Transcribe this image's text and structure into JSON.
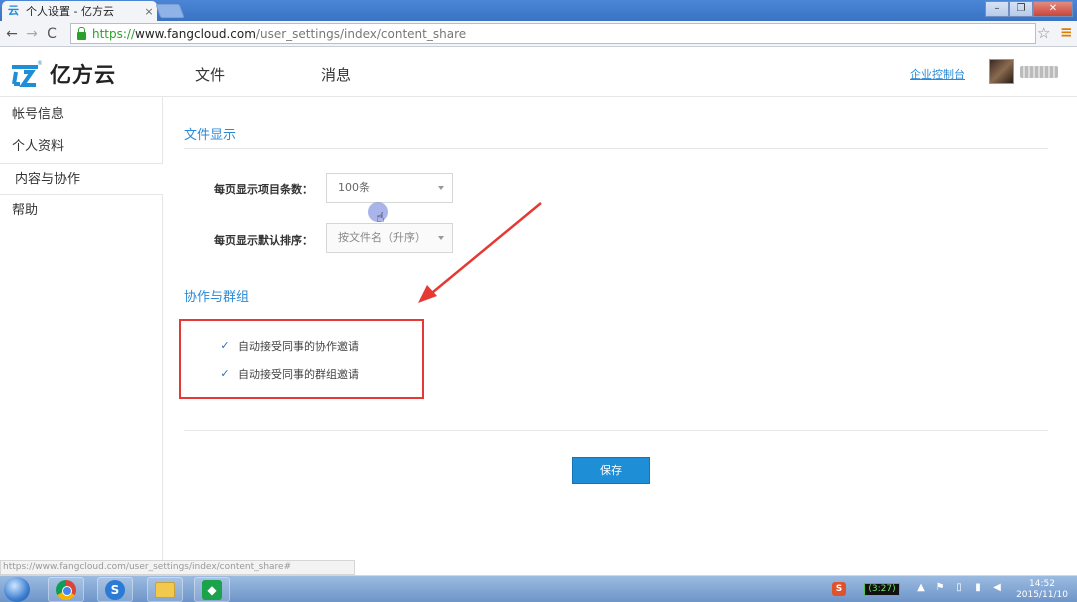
{
  "browser": {
    "tab_title": "个人设置 - 亿方云",
    "tab_close": "×",
    "url_scheme": "https://",
    "url_host": "www.fangcloud.com",
    "url_path": "/user_settings/index/content_share",
    "back": "←",
    "forward": "→",
    "reload": "C",
    "window_minimize": "–",
    "window_restore": "❐",
    "window_close": "✕",
    "bookmark_star": "☆",
    "menu": "≡"
  },
  "header": {
    "logo_text": "亿方云",
    "nav": [
      "文件",
      "消息"
    ],
    "admin_link": "企业控制台"
  },
  "sidebar": {
    "items": [
      {
        "label": "帐号信息"
      },
      {
        "label": "个人资料"
      },
      {
        "label": "内容与协作",
        "active": true
      },
      {
        "label": "帮助"
      }
    ]
  },
  "main": {
    "file_display_title": "文件显示",
    "items_per_page_label": "每页显示项目条数：",
    "items_per_page_value": "100条",
    "default_sort_label": "每页显示默认排序：",
    "default_sort_value": "按文件名（升序）",
    "collab_title": "协作与群组",
    "checkboxes": [
      {
        "label": "自动接受同事的协作邀请",
        "checked": true
      },
      {
        "label": "自动接受同事的群组邀请",
        "checked": true
      }
    ],
    "check_glyph": "✓",
    "save_label": "保存"
  },
  "statusbar": {
    "hover_url": "https://www.fangcloud.com/user_settings/index/content_share#"
  },
  "taskbar": {
    "sogou_glyph": "S",
    "tray_ime": "S",
    "battery": "(3:27)",
    "time": "14:52",
    "date": "2015/11/10"
  },
  "colors": {
    "accent_blue": "#2a8ad8",
    "save_button": "#1e8fd6",
    "highlight_red": "#e53935"
  }
}
